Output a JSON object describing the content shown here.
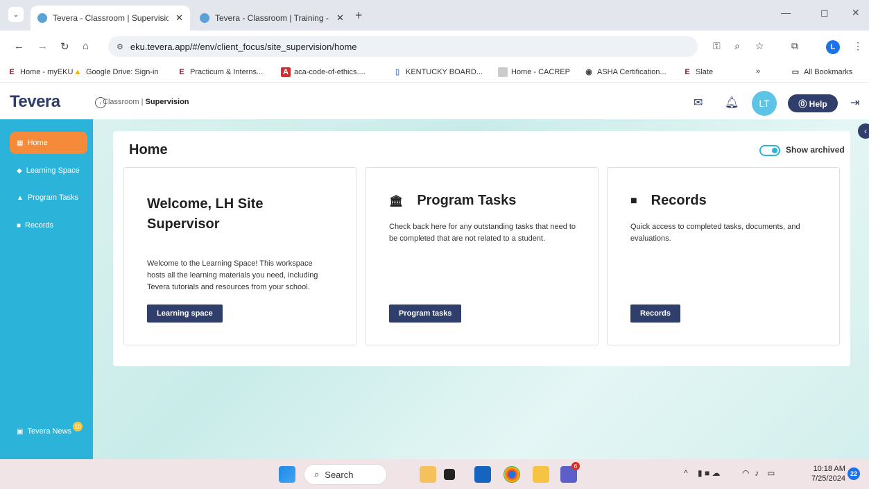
{
  "browser": {
    "tabs": [
      {
        "title": "Tevera - Classroom | Supervisio",
        "close": "✕"
      },
      {
        "title": "Tevera - Classroom | Training - |",
        "close": "✕"
      }
    ],
    "new_tab": "+",
    "url": "eku.tevera.app/#/env/client_focus/site_supervision/home",
    "profile_initial": "L",
    "bookmarks": [
      {
        "label": "Home - myEKU",
        "icon": "eku-icon"
      },
      {
        "label": "Google Drive: Sign-in",
        "icon": "drive-icon"
      },
      {
        "label": "Practicum & Interns...",
        "icon": "eku-icon"
      },
      {
        "label": "aca-code-of-ethics....",
        "icon": "pdf-icon"
      },
      {
        "label": "KENTUCKY BOARD...",
        "icon": "doc-icon"
      },
      {
        "label": "Home - CACREP",
        "icon": "page-icon"
      },
      {
        "label": "ASHA Certification...",
        "icon": "globe-icon"
      },
      {
        "label": "Slate",
        "icon": "eku-icon"
      }
    ],
    "bookmarks_overflow": "»",
    "all_bookmarks": "All Bookmarks"
  },
  "app": {
    "logo": "Tevera",
    "breadcrumb_classroom": "Classroom | ",
    "breadcrumb_current": "Supervision",
    "avatar_initials": "LT",
    "help_label": "⓪ Help"
  },
  "sidebar": {
    "items": [
      {
        "label": "Home",
        "icon": "home-icon"
      },
      {
        "label": "Learning Space",
        "icon": "graduation-cap-icon"
      },
      {
        "label": "Program Tasks",
        "icon": "building-icon"
      },
      {
        "label": "Records",
        "icon": "folder-icon"
      }
    ],
    "news_label": "Tevera News",
    "news_count": "10"
  },
  "page": {
    "title": "Home",
    "toggle_label": "Show archived",
    "cards": [
      {
        "title": "Welcome, LH Site Supervisor",
        "description": "Welcome to the Learning Space! This workspace hosts all the learning materials you need, including Tevera tutorials and resources from your school.",
        "button": "Learning space"
      },
      {
        "title": "Program Tasks",
        "icon": "building-icon",
        "description": "Check back here for any outstanding tasks that need to be completed that are not related to a student.",
        "button": "Program tasks"
      },
      {
        "title": "Records",
        "icon": "folder-icon",
        "description": "Quick access to completed tasks, documents, and evaluations.",
        "button": "Records"
      }
    ]
  },
  "taskbar": {
    "search_label": "Search",
    "time": "10:18 AM",
    "date": "7/25/2024",
    "notifications": "22",
    "teams_badge": "6"
  }
}
